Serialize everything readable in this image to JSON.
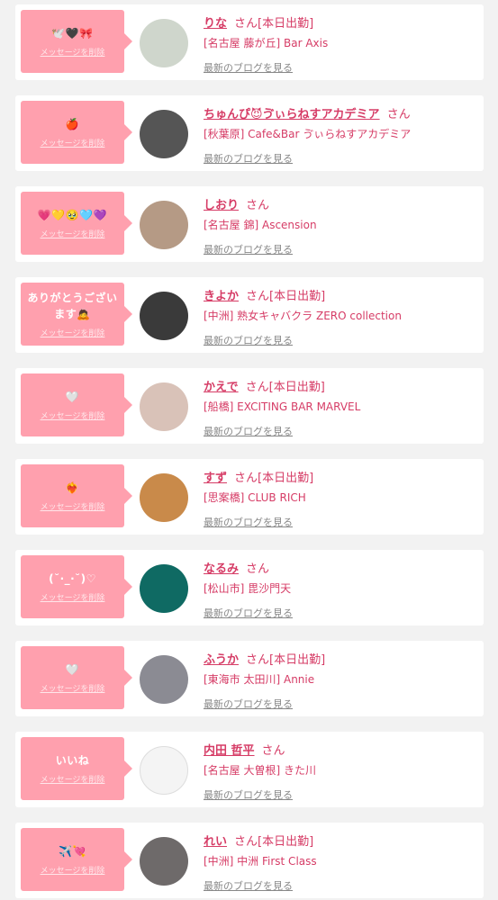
{
  "cards": [
    {
      "msg": "🕊️🖤🎀",
      "del": "メッセージを削除",
      "name": "りな",
      "san": "さん",
      "status": "[本日出勤]",
      "shop": "[名古屋 藤が丘] Bar Axis",
      "blog": "最新のブログを見る",
      "avatar_color": "#cfd6cc"
    },
    {
      "msg": "🍎",
      "del": "メッセージを削除",
      "name": "ちゅんぴ😈ゔぃらねすアカデミア",
      "san": "さん",
      "status": "",
      "shop": "[秋葉原] Cafe&Bar ゔぃらねすアカデミア",
      "blog": "最新のブログを見る",
      "avatar_color": "#555555"
    },
    {
      "msg": "💗💛🥹🩵💜",
      "del": "メッセージを削除",
      "name": "しおり",
      "san": "さん",
      "status": "",
      "shop": "[名古屋 錦] Ascension",
      "blog": "最新のブログを見る",
      "avatar_color": "#b59a85"
    },
    {
      "msg": "ありがとうございます🙇",
      "del": "メッセージを削除",
      "name": "きよか",
      "san": "さん",
      "status": "[本日出勤]",
      "shop": "[中洲] 熟女キャバクラ ZERO collection",
      "blog": "最新のブログを見る",
      "avatar_color": "#3a3a3a"
    },
    {
      "msg": "🤍",
      "del": "メッセージを削除",
      "name": "かえで",
      "san": "さん",
      "status": "[本日出勤]",
      "shop": "[船橋] EXCITING BAR MARVEL",
      "blog": "最新のブログを見る",
      "avatar_color": "#d9c2b8"
    },
    {
      "msg": "❤️‍🔥",
      "del": "メッセージを削除",
      "name": "すず",
      "san": "さん",
      "status": "[本日出勤]",
      "shop": "[思案橋] CLUB RICH",
      "blog": "最新のブログを見る",
      "avatar_color": "#c98a4a"
    },
    {
      "msg": "(˘·_·˘)♡",
      "del": "メッセージを削除",
      "name": "なるみ",
      "san": "さん",
      "status": "",
      "shop": "[松山市] 毘沙門天",
      "blog": "最新のブログを見る",
      "avatar_color": "#0f6a63"
    },
    {
      "msg": "🤍",
      "del": "メッセージを削除",
      "name": "ふうか",
      "san": "さん",
      "status": "[本日出勤]",
      "shop": "[東海市 太田川] Annie",
      "blog": "最新のブログを見る",
      "avatar_color": "#8b8b93"
    },
    {
      "msg": "いいね",
      "del": "メッセージを削除",
      "name": "内田 哲平",
      "san": "さん",
      "status": "",
      "shop": "[名古屋 大曽根] きた川",
      "blog": "最新のブログを見る",
      "avatar_color": "#f4f4f4"
    },
    {
      "msg": "✈️💘",
      "del": "メッセージを削除",
      "name": "れい",
      "san": "さん",
      "status": "[本日出勤]",
      "shop": "[中洲] 中洲 First Class",
      "blog": "最新のブログを見る",
      "avatar_color": "#6e6a6a"
    }
  ]
}
